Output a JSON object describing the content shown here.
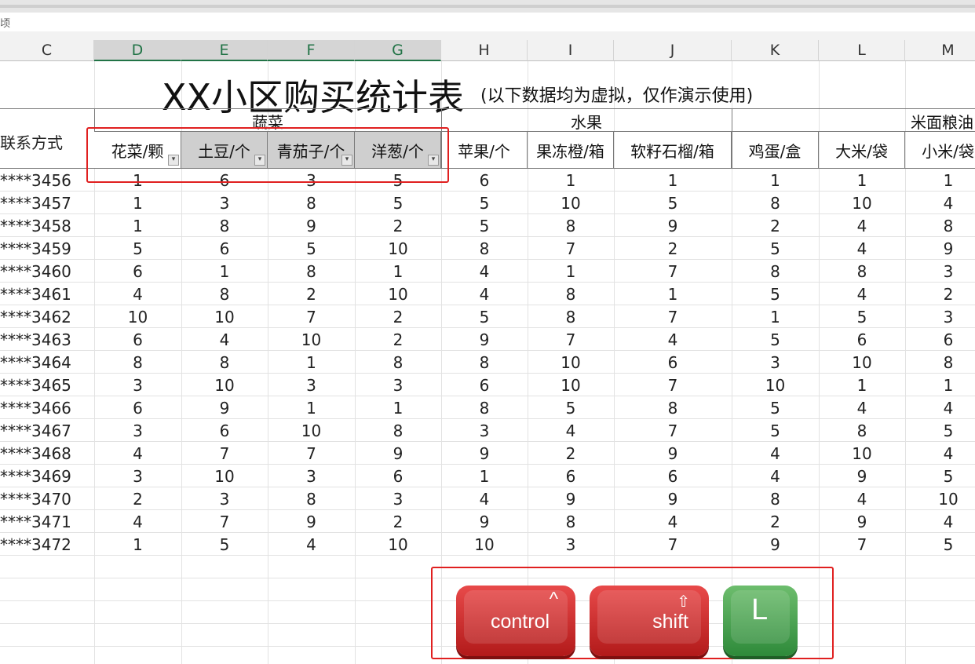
{
  "formula_bar": {
    "text": "顷"
  },
  "column_headers": [
    {
      "label": "C",
      "selected": false
    },
    {
      "label": "D",
      "selected": true
    },
    {
      "label": "E",
      "selected": true
    },
    {
      "label": "F",
      "selected": true
    },
    {
      "label": "G",
      "selected": true
    },
    {
      "label": "H",
      "selected": false
    },
    {
      "label": "I",
      "selected": false
    },
    {
      "label": "J",
      "selected": false
    },
    {
      "label": "K",
      "selected": false
    },
    {
      "label": "L",
      "selected": false
    },
    {
      "label": "M",
      "selected": false
    }
  ],
  "sheet": {
    "title": "XX小区购买统计表",
    "subtitle": "(以下数据均为虚拟，仅作演示使用)",
    "contact_header": "联系方式",
    "groups": [
      "蔬菜",
      "水果",
      "米面粮油"
    ],
    "headers": [
      "花菜/颗",
      "土豆/个",
      "青茄子/个",
      "洋葱/个",
      "苹果/个",
      "果冻橙/箱",
      "软籽石榴/箱",
      "鸡蛋/盒",
      "大米/袋",
      "小米/袋"
    ],
    "rows": [
      {
        "phone": "****3456",
        "values": [
          "1",
          "6",
          "3",
          "5",
          "6",
          "1",
          "1",
          "1",
          "1",
          "1"
        ]
      },
      {
        "phone": "****3457",
        "values": [
          "1",
          "3",
          "8",
          "5",
          "5",
          "10",
          "5",
          "8",
          "10",
          "4"
        ]
      },
      {
        "phone": "****3458",
        "values": [
          "1",
          "8",
          "9",
          "2",
          "5",
          "8",
          "9",
          "2",
          "4",
          "8"
        ]
      },
      {
        "phone": "****3459",
        "values": [
          "5",
          "6",
          "5",
          "10",
          "8",
          "7",
          "2",
          "5",
          "4",
          "9"
        ]
      },
      {
        "phone": "****3460",
        "values": [
          "6",
          "1",
          "8",
          "1",
          "4",
          "1",
          "7",
          "8",
          "8",
          "3"
        ]
      },
      {
        "phone": "****3461",
        "values": [
          "4",
          "8",
          "2",
          "10",
          "4",
          "8",
          "1",
          "5",
          "4",
          "2"
        ]
      },
      {
        "phone": "****3462",
        "values": [
          "10",
          "10",
          "7",
          "2",
          "5",
          "8",
          "7",
          "1",
          "5",
          "3"
        ]
      },
      {
        "phone": "****3463",
        "values": [
          "6",
          "4",
          "10",
          "2",
          "9",
          "7",
          "4",
          "5",
          "6",
          "6"
        ]
      },
      {
        "phone": "****3464",
        "values": [
          "8",
          "8",
          "1",
          "8",
          "8",
          "10",
          "6",
          "3",
          "10",
          "8"
        ]
      },
      {
        "phone": "****3465",
        "values": [
          "3",
          "10",
          "3",
          "3",
          "6",
          "10",
          "7",
          "10",
          "1",
          "1"
        ]
      },
      {
        "phone": "****3466",
        "values": [
          "6",
          "9",
          "1",
          "1",
          "8",
          "5",
          "8",
          "5",
          "4",
          "4"
        ]
      },
      {
        "phone": "****3467",
        "values": [
          "3",
          "6",
          "10",
          "8",
          "3",
          "4",
          "7",
          "5",
          "8",
          "5"
        ]
      },
      {
        "phone": "****3468",
        "values": [
          "4",
          "7",
          "7",
          "9",
          "9",
          "2",
          "9",
          "4",
          "10",
          "4"
        ]
      },
      {
        "phone": "****3469",
        "values": [
          "3",
          "10",
          "3",
          "6",
          "1",
          "6",
          "6",
          "4",
          "9",
          "5"
        ]
      },
      {
        "phone": "****3470",
        "values": [
          "2",
          "3",
          "8",
          "3",
          "4",
          "9",
          "9",
          "8",
          "4",
          "10"
        ]
      },
      {
        "phone": "****3471",
        "values": [
          "4",
          "7",
          "9",
          "2",
          "9",
          "8",
          "4",
          "2",
          "9",
          "4"
        ]
      },
      {
        "phone": "****3472",
        "values": [
          "1",
          "5",
          "4",
          "10",
          "10",
          "3",
          "7",
          "9",
          "7",
          "5"
        ]
      }
    ]
  },
  "shortcut_keys": {
    "key1": "control",
    "key2": "shift",
    "key3": "L",
    "key1_symbol": "^",
    "key2_symbol": "⇧"
  },
  "colors": {
    "highlight_red": "#e02020",
    "key_red": "#d12b2b",
    "key_green": "#3f9a47",
    "excel_green": "#217346"
  }
}
